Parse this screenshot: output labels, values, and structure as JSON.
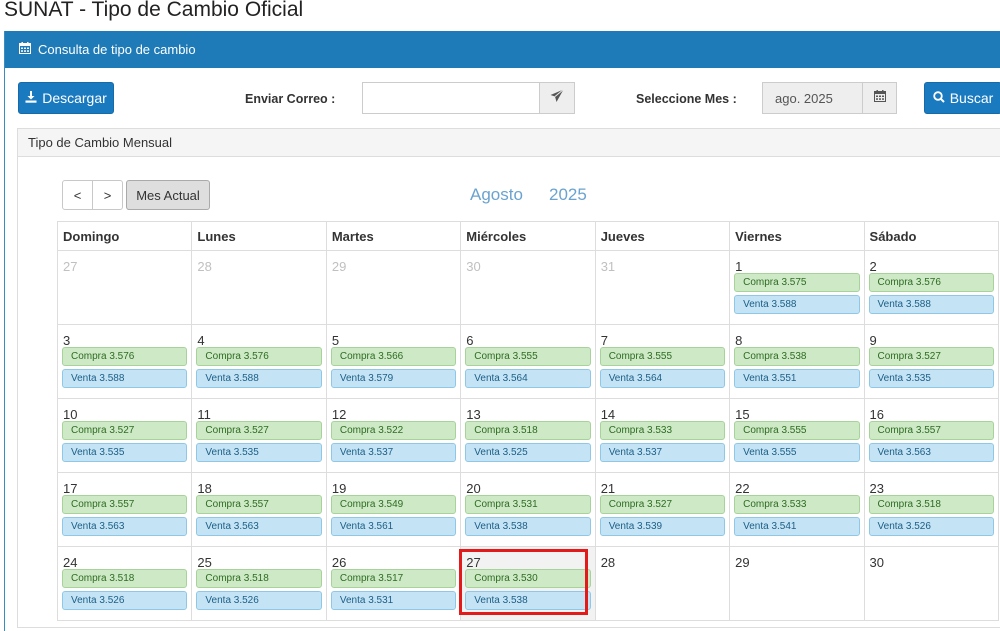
{
  "page": {
    "title": "SUNAT - Tipo de Cambio Oficial"
  },
  "panel": {
    "heading": "Consulta de tipo de cambio",
    "heading_icon": "calendar-icon"
  },
  "toolbar": {
    "download_label": "Descargar",
    "download_icon": "download-icon",
    "email_label": "Enviar Correo :",
    "email_value": "",
    "send_icon": "paper-plane-icon",
    "month_label": "Seleccione Mes :",
    "month_value": "ago. 2025",
    "month_icon": "calendar-icon",
    "search_label": "Buscar",
    "search_icon": "search-icon"
  },
  "monthly": {
    "heading": "Tipo de Cambio Mensual",
    "prev_label": "<",
    "next_label": ">",
    "current_label": "Mes Actual",
    "month_name": "Agosto",
    "year": "2025",
    "weekdays": [
      "Domingo",
      "Lunes",
      "Martes",
      "Miércoles",
      "Jueves",
      "Viernes",
      "Sábado"
    ],
    "weeks": [
      [
        {
          "day": "27",
          "other": true
        },
        {
          "day": "28",
          "other": true
        },
        {
          "day": "29",
          "other": true
        },
        {
          "day": "30",
          "other": true
        },
        {
          "day": "31",
          "other": true
        },
        {
          "day": "1",
          "buy": "Compra 3.575",
          "sell": "Venta 3.588"
        },
        {
          "day": "2",
          "buy": "Compra 3.576",
          "sell": "Venta 3.588"
        }
      ],
      [
        {
          "day": "3",
          "buy": "Compra 3.576",
          "sell": "Venta 3.588"
        },
        {
          "day": "4",
          "buy": "Compra 3.576",
          "sell": "Venta 3.588"
        },
        {
          "day": "5",
          "buy": "Compra 3.566",
          "sell": "Venta 3.579"
        },
        {
          "day": "6",
          "buy": "Compra 3.555",
          "sell": "Venta 3.564"
        },
        {
          "day": "7",
          "buy": "Compra 3.555",
          "sell": "Venta 3.564"
        },
        {
          "day": "8",
          "buy": "Compra 3.538",
          "sell": "Venta 3.551"
        },
        {
          "day": "9",
          "buy": "Compra 3.527",
          "sell": "Venta 3.535"
        }
      ],
      [
        {
          "day": "10",
          "buy": "Compra 3.527",
          "sell": "Venta 3.535"
        },
        {
          "day": "11",
          "buy": "Compra 3.527",
          "sell": "Venta 3.535"
        },
        {
          "day": "12",
          "buy": "Compra 3.522",
          "sell": "Venta 3.537"
        },
        {
          "day": "13",
          "buy": "Compra 3.518",
          "sell": "Venta 3.525"
        },
        {
          "day": "14",
          "buy": "Compra 3.533",
          "sell": "Venta 3.537"
        },
        {
          "day": "15",
          "buy": "Compra 3.555",
          "sell": "Venta 3.555"
        },
        {
          "day": "16",
          "buy": "Compra 3.557",
          "sell": "Venta 3.563"
        }
      ],
      [
        {
          "day": "17",
          "buy": "Compra 3.557",
          "sell": "Venta 3.563"
        },
        {
          "day": "18",
          "buy": "Compra 3.557",
          "sell": "Venta 3.563"
        },
        {
          "day": "19",
          "buy": "Compra 3.549",
          "sell": "Venta 3.561"
        },
        {
          "day": "20",
          "buy": "Compra 3.531",
          "sell": "Venta 3.538"
        },
        {
          "day": "21",
          "buy": "Compra 3.527",
          "sell": "Venta 3.539"
        },
        {
          "day": "22",
          "buy": "Compra 3.533",
          "sell": "Venta 3.541"
        },
        {
          "day": "23",
          "buy": "Compra 3.518",
          "sell": "Venta 3.526"
        }
      ],
      [
        {
          "day": "24",
          "buy": "Compra 3.518",
          "sell": "Venta 3.526"
        },
        {
          "day": "25",
          "buy": "Compra 3.518",
          "sell": "Venta 3.526"
        },
        {
          "day": "26",
          "buy": "Compra 3.517",
          "sell": "Venta 3.531"
        },
        {
          "day": "27",
          "buy": "Compra 3.530",
          "sell": "Venta 3.538",
          "today": true
        },
        {
          "day": "28"
        },
        {
          "day": "29"
        },
        {
          "day": "30"
        }
      ]
    ]
  },
  "colors": {
    "header_blue": "#1e7bb8",
    "button_blue": "#1a7ac0",
    "buy_green": "#cde9c6",
    "sell_blue": "#c4e4f5",
    "highlight_red": "#e21a1a",
    "month_text": "#6aa3cf"
  }
}
